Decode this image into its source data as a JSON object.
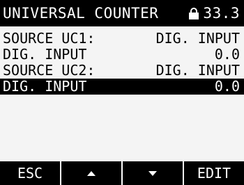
{
  "header": {
    "title": "UNIVERSAL COUNTER",
    "lock_icon": "lock-icon",
    "value": "33.3"
  },
  "rows": [
    {
      "label": "SOURCE UC1:",
      "value": "DIG. INPUT",
      "selected": false
    },
    {
      "label": "DIG. INPUT",
      "value": "0.0",
      "selected": false
    },
    {
      "label": "SOURCE UC2:",
      "value": "DIG. INPUT",
      "selected": false
    },
    {
      "label": "DIG. INPUT",
      "value": "0.0",
      "selected": true
    }
  ],
  "softkeys": {
    "esc": "ESC",
    "up_icon": "arrow-up-icon",
    "down_icon": "arrow-down-icon",
    "edit": "EDIT"
  },
  "colors": {
    "background": "#f4f4f4",
    "foreground": "#000000",
    "highlight": "#000000"
  }
}
